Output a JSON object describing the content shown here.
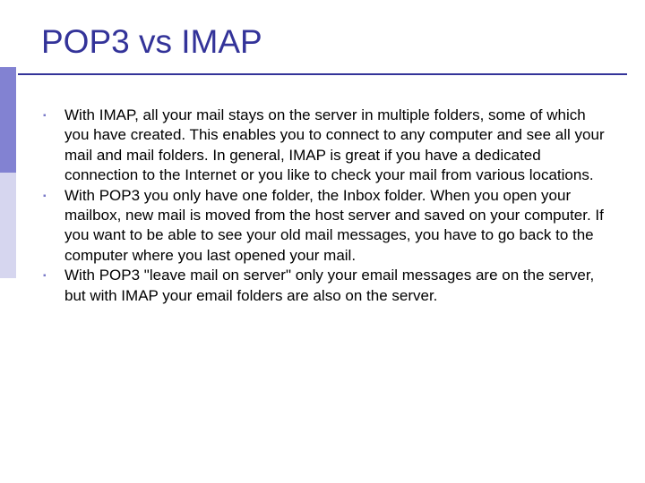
{
  "heading": "POP3 vs IMAP",
  "bullets": [
    "With IMAP, all your mail stays on the server in multiple folders, some of which you have created. This enables you to connect to any computer and see all your mail and mail folders. In general, IMAP is great if you have a dedicated connection to the Internet or you like to check your mail from various locations.",
    "With POP3 you only have one folder, the Inbox folder. When you open your mailbox, new mail is moved from the host server and saved on your computer. If you want to be able to see your old mail messages, you have to go back to the computer where you last opened your mail.",
    "With POP3 \"leave mail on server\" only your email messages are on the server, but with IMAP your email folders are also on the server."
  ]
}
